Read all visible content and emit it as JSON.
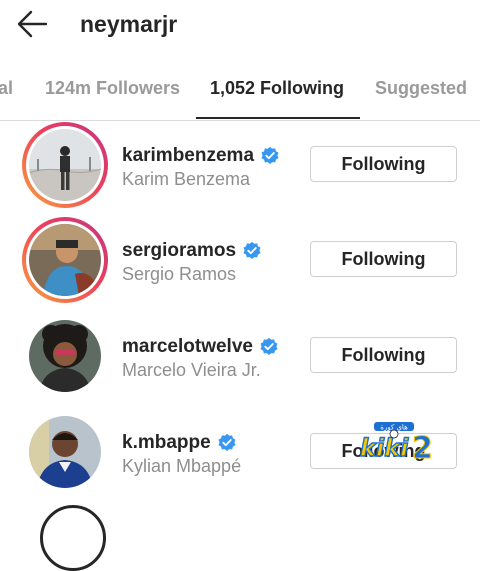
{
  "header": {
    "back_icon": "arrow-left-icon",
    "username": "neymarjr"
  },
  "tabs": [
    {
      "label": "al",
      "active": false
    },
    {
      "label": "124m Followers",
      "active": false
    },
    {
      "label": "1,052 Following",
      "active": true
    },
    {
      "label": "Suggested",
      "active": false
    }
  ],
  "following_list": [
    {
      "handle": "karimbenzema",
      "name": "Karim Benzema",
      "verified": true,
      "has_story": true,
      "button": "Following"
    },
    {
      "handle": "sergioramos",
      "name": "Sergio Ramos",
      "verified": true,
      "has_story": true,
      "button": "Following"
    },
    {
      "handle": "marcelotwelve",
      "name": "Marcelo Vieira Jr.",
      "verified": true,
      "has_story": false,
      "button": "Following"
    },
    {
      "handle": "k.mbappe",
      "name": "Kylian Mbappé",
      "verified": true,
      "has_story": false,
      "button": "Following"
    }
  ],
  "watermark": {
    "text_arabic": "هاي كورة",
    "text_large": "kiki 2"
  },
  "colors": {
    "verified_blue": "#3897f0",
    "story_ring_start": "#f9a43d",
    "story_ring_end": "#c13584",
    "secondary_text": "#8e8e8e",
    "watermark_blue": "#1d6fd1",
    "watermark_yellow": "#f6c800"
  }
}
